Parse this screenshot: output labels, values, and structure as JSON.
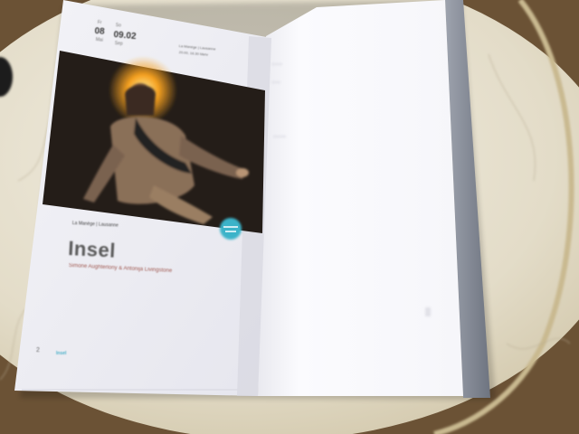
{
  "booklet": {
    "dates": {
      "start_day_label": "Fr",
      "start_date": "08",
      "start_month": "Mai",
      "end_day_label": "So",
      "end_date": "09.02",
      "end_month": "Sep"
    },
    "venue_line_1": "La Manège | Lausanne",
    "venue_line_2": "20.00, 16.30 Mehr",
    "series_label": "La Manège | Lausanne",
    "title": "Insel",
    "authors": "Simone Aughterlony & Antonija Livingstone",
    "page_number": "2",
    "footer_tag": "Insel"
  },
  "colors": {
    "badge": "#3bb3c9",
    "accent_text": "#a05a52",
    "tabletop": "#e9e3d2",
    "page": "#f4f4f8"
  }
}
